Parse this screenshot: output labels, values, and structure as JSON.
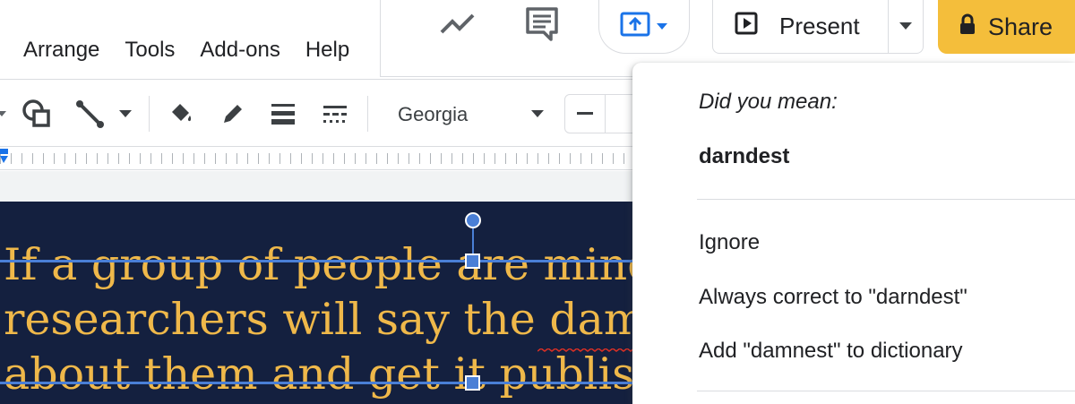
{
  "header": {
    "present_label": "Present",
    "share_label": "Share",
    "icons": [
      "explore-trend-icon",
      "comment-icon",
      "present-upload-icon",
      "present-icon",
      "lock-icon"
    ]
  },
  "menubar": {
    "items": [
      {
        "label": "Arrange"
      },
      {
        "label": "Tools"
      },
      {
        "label": "Add-ons"
      },
      {
        "label": "Help"
      }
    ]
  },
  "toolbar": {
    "font_name": "Georgia",
    "decrease_label": "−"
  },
  "slide": {
    "lines": [
      "If a group of people are mind",
      "researchers will say the damn",
      "about them and get it publis"
    ],
    "colors": {
      "background": "#14203f",
      "text": "#efb84a",
      "selection": "#4a7fd6"
    }
  },
  "spell_menu": {
    "did_you_mean": "Did you mean:",
    "suggestion": "darndest",
    "ignore": "Ignore",
    "always_correct": "Always correct to \"darndest\"",
    "add_to_dictionary": "Add \"damnest\" to dictionary"
  },
  "colors": {
    "share": "#f4be3b",
    "accent": "#1a73e8"
  }
}
